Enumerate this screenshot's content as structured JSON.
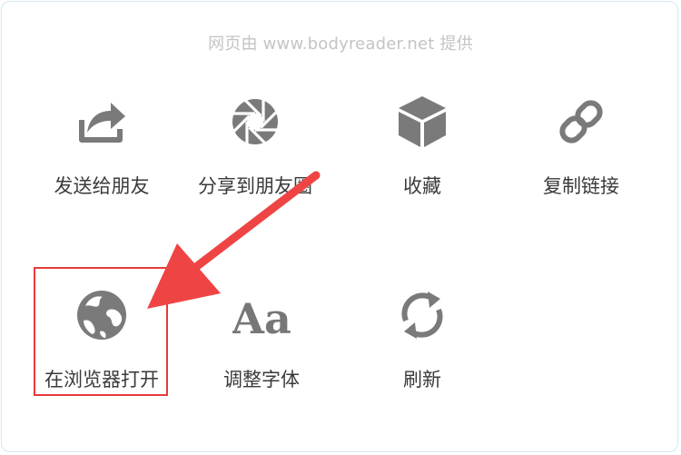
{
  "header": {
    "provider_text": "网页由 www.bodyreader.net 提供"
  },
  "actions": [
    {
      "label": "发送给朋友",
      "icon": "share-forward-icon"
    },
    {
      "label": "分享到朋友圈",
      "icon": "moments-shutter-icon"
    },
    {
      "label": "收藏",
      "icon": "favorites-cube-icon"
    },
    {
      "label": "复制链接",
      "icon": "link-icon"
    },
    {
      "label": "在浏览器打开",
      "icon": "globe-icon"
    },
    {
      "label": "调整字体",
      "icon": "font-size-icon",
      "glyph": "Aa"
    },
    {
      "label": "刷新",
      "icon": "refresh-icon"
    }
  ],
  "annotation": {
    "highlighted_action": "在浏览器打开",
    "color": "#e53a3a"
  },
  "colors": {
    "icon": "#7a7a7a",
    "label": "#3a3a3a",
    "provider_text": "#c4c4c4",
    "annotation": "#e53a3a"
  }
}
